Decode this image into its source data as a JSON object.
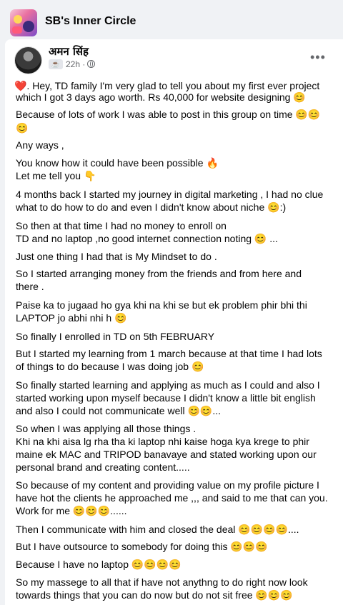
{
  "group": {
    "name": "SB's Inner Circle"
  },
  "author": {
    "name": "अमन सिंह",
    "time": "22h ·"
  },
  "post_lines": [
    "❤️. Hey, TD family I'm very glad to tell you about my first ever project",
    "which I got 3 days ago worth. Rs 40,000 for website designing 😊",
    "Because of lots of work I was able to post in this group on time 😊😊",
    "😊",
    "Any ways ,",
    "You know how it could have been possible 🔥",
    "Let me tell you 👇",
    "4 months back I started my journey in digital marketing , I had no clue",
    "what to do how to do and even I didn't know about niche 😊:)",
    "So then at that time I had no money to enroll on",
    "TD and no laptop ,no good internet connection noting 😊 ...",
    "Just one thing I had that is My Mindset to do .",
    "So I started  arranging money from the friends and from here and",
    "there .",
    "Paise ka to jugaad ho gya khi na khi se but ek problem phir bhi thi",
    "LAPTOP jo abhi nhi h 😊",
    "So finally I enrolled in TD on 5th FEBRUARY",
    "But I started my learning from 1 march because at that time I had lots",
    "of things to do because I was doing job 😊",
    "So finally started learning and applying as much as I could and also I",
    "started working upon myself because I didn't know a little bit english",
    "and also I could not communicate well 😊😊...",
    "So when I was applying all those things .",
    "Khi na khi aisa lg rha tha ki laptop nhi kaise hoga kya krege to phir",
    "maine ek MAC and TRIPOD banavaye and stated working upon our",
    "personal brand and creating content.....",
    "So because of my content and providing value on my profile picture I",
    "have hot the clients he approached me ,,, and said to me that can you.",
    "Work for me 😊😊😊......",
    "Then I communicate with him and closed the deal 😊😊😊😊....",
    "But  I have outsource to somebody for doing this 😊😊😊",
    "Because I have no laptop 😊😊😊😊",
    "So my massege to all that if have not anythng to do right now look",
    "towards things that you can do now but do not sit free 😊😊😊"
  ]
}
